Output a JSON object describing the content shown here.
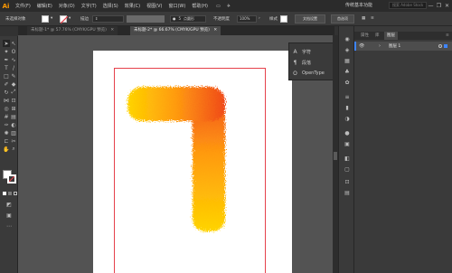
{
  "app": {
    "logo": "Ai",
    "workspace": "传统基本功能",
    "search_placeholder": "搜索 Adobe Stock"
  },
  "menu": [
    "文件(F)",
    "编辑(E)",
    "对象(O)",
    "文字(T)",
    "选择(S)",
    "效果(C)",
    "视图(V)",
    "窗口(W)",
    "帮助(H)"
  ],
  "window_controls": {
    "minimize": "—",
    "restore": "❐",
    "close": "✕"
  },
  "control_bar": {
    "selection_label": "未选择对象",
    "stroke_label": "描边",
    "brush_dot": "●",
    "brush_size": "5",
    "brush_style": "点圆形",
    "opacity_label": "不透明度",
    "opacity_value": "100%",
    "style_label": "样式",
    "doc_setup_button": "文档设置",
    "prefs_button": "首选项"
  },
  "tabs": [
    {
      "label": "未标题-1* @ 57.76% (CMYK/GPU 预览)",
      "close": "✕"
    },
    {
      "label": "未标题-2* @ 66.67% (CMYK/GPU 预览)",
      "close": "✕"
    }
  ],
  "char_panel": {
    "items": [
      {
        "icon": "A",
        "label": "字符"
      },
      {
        "icon": "¶",
        "label": "段落"
      },
      {
        "icon": "O",
        "label": "OpenType"
      }
    ]
  },
  "layers_panel": {
    "tabs": [
      "属性",
      "库",
      "图层"
    ],
    "menu_icon": "≡",
    "layer": {
      "eye": "👁",
      "caret": "›",
      "name": "图层 1"
    }
  },
  "colors": {
    "accent": "#3e85ff",
    "artboard_border": "#e5414b",
    "fur_light": "#ffd400",
    "fur_dark": "#f04a1a"
  }
}
